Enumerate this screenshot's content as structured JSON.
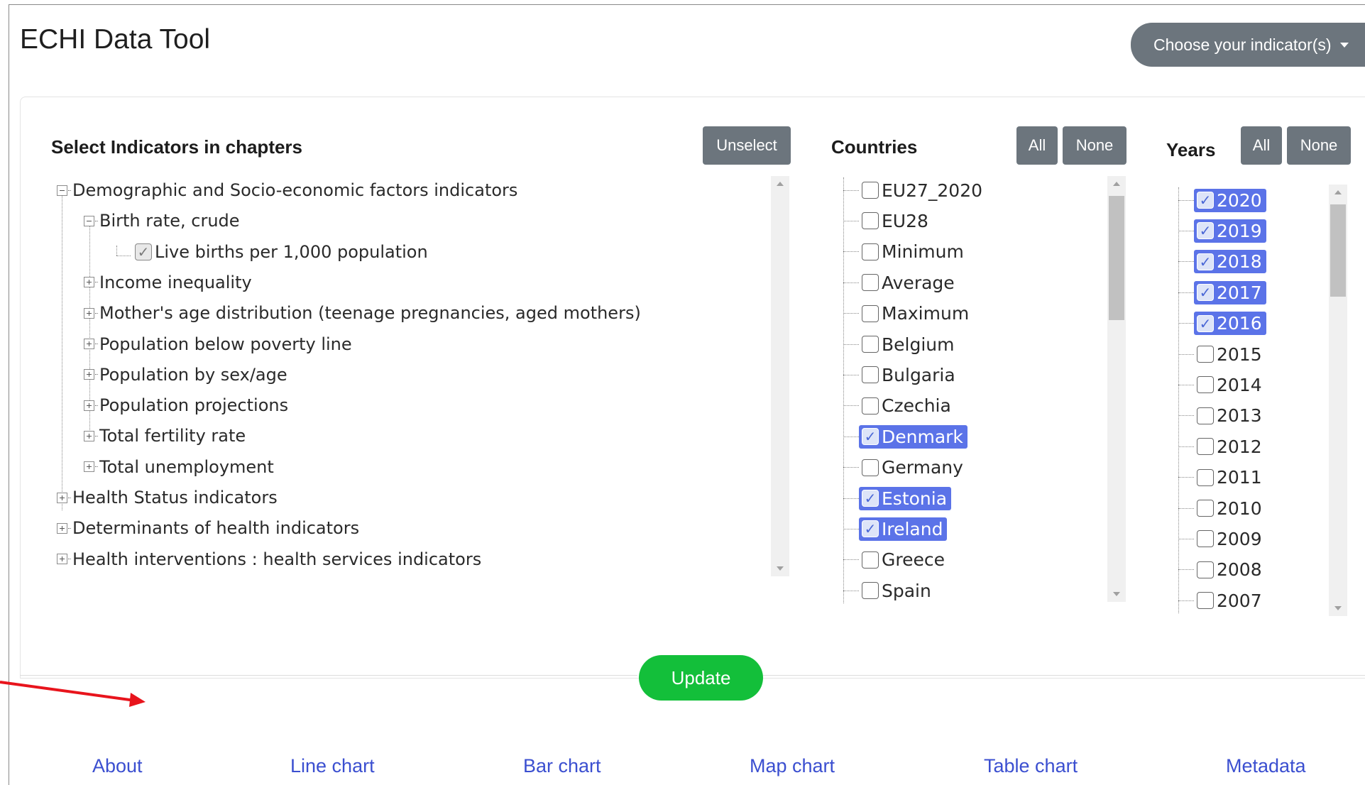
{
  "app": {
    "title": "ECHI Data Tool",
    "indicator_button": "Choose your indicator(s)"
  },
  "indicators": {
    "header": "Select Indicators in chapters",
    "unselect_label": "Unselect",
    "tree": [
      {
        "label": "Demographic and Socio-economic factors indicators",
        "level": 0,
        "expanded": true
      },
      {
        "label": "Birth rate, crude",
        "level": 1,
        "expanded": true
      },
      {
        "label": "Live births per 1,000 population",
        "level": 2,
        "checked": true
      },
      {
        "label": "Income inequality",
        "level": 1,
        "expanded": false
      },
      {
        "label": "Mother's age distribution (teenage pregnancies, aged mothers)",
        "level": 1,
        "expanded": false
      },
      {
        "label": "Population below poverty line",
        "level": 1,
        "expanded": false
      },
      {
        "label": "Population by sex/age",
        "level": 1,
        "expanded": false
      },
      {
        "label": "Population projections",
        "level": 1,
        "expanded": false
      },
      {
        "label": "Total fertility rate",
        "level": 1,
        "expanded": false
      },
      {
        "label": "Total unemployment",
        "level": 1,
        "expanded": false
      },
      {
        "label": "Health Status indicators",
        "level": 0,
        "expanded": false
      },
      {
        "label": "Determinants of health indicators",
        "level": 0,
        "expanded": false
      },
      {
        "label": "Health interventions : health services indicators",
        "level": 0,
        "expanded": false
      }
    ]
  },
  "countries": {
    "header": "Countries",
    "all_label": "All",
    "none_label": "None",
    "items": [
      {
        "label": "EU27_2020",
        "selected": false
      },
      {
        "label": "EU28",
        "selected": false
      },
      {
        "label": "Minimum",
        "selected": false
      },
      {
        "label": "Average",
        "selected": false
      },
      {
        "label": "Maximum",
        "selected": false
      },
      {
        "label": "Belgium",
        "selected": false
      },
      {
        "label": "Bulgaria",
        "selected": false
      },
      {
        "label": "Czechia",
        "selected": false
      },
      {
        "label": "Denmark",
        "selected": true
      },
      {
        "label": "Germany",
        "selected": false
      },
      {
        "label": "Estonia",
        "selected": true
      },
      {
        "label": "Ireland",
        "selected": true
      },
      {
        "label": "Greece",
        "selected": false
      },
      {
        "label": "Spain",
        "selected": false
      }
    ]
  },
  "years": {
    "header": "Years",
    "all_label": "All",
    "none_label": "None",
    "items": [
      {
        "label": "2020",
        "selected": true
      },
      {
        "label": "2019",
        "selected": true
      },
      {
        "label": "2018",
        "selected": true
      },
      {
        "label": "2017",
        "selected": true
      },
      {
        "label": "2016",
        "selected": true
      },
      {
        "label": "2015",
        "selected": false
      },
      {
        "label": "2014",
        "selected": false
      },
      {
        "label": "2013",
        "selected": false
      },
      {
        "label": "2012",
        "selected": false
      },
      {
        "label": "2011",
        "selected": false
      },
      {
        "label": "2010",
        "selected": false
      },
      {
        "label": "2009",
        "selected": false
      },
      {
        "label": "2008",
        "selected": false
      },
      {
        "label": "2007",
        "selected": false
      }
    ]
  },
  "update_label": "Update",
  "footer": {
    "links": [
      "About",
      "Line chart",
      "Bar chart",
      "Map chart",
      "Table chart",
      "Metadata"
    ]
  },
  "colors": {
    "selected_chip": "#5b73e8",
    "button_grey": "#6c757d",
    "update_green": "#13bf3a",
    "link_blue": "#3b4fd0",
    "annotation_arrow": "#e8141c"
  }
}
